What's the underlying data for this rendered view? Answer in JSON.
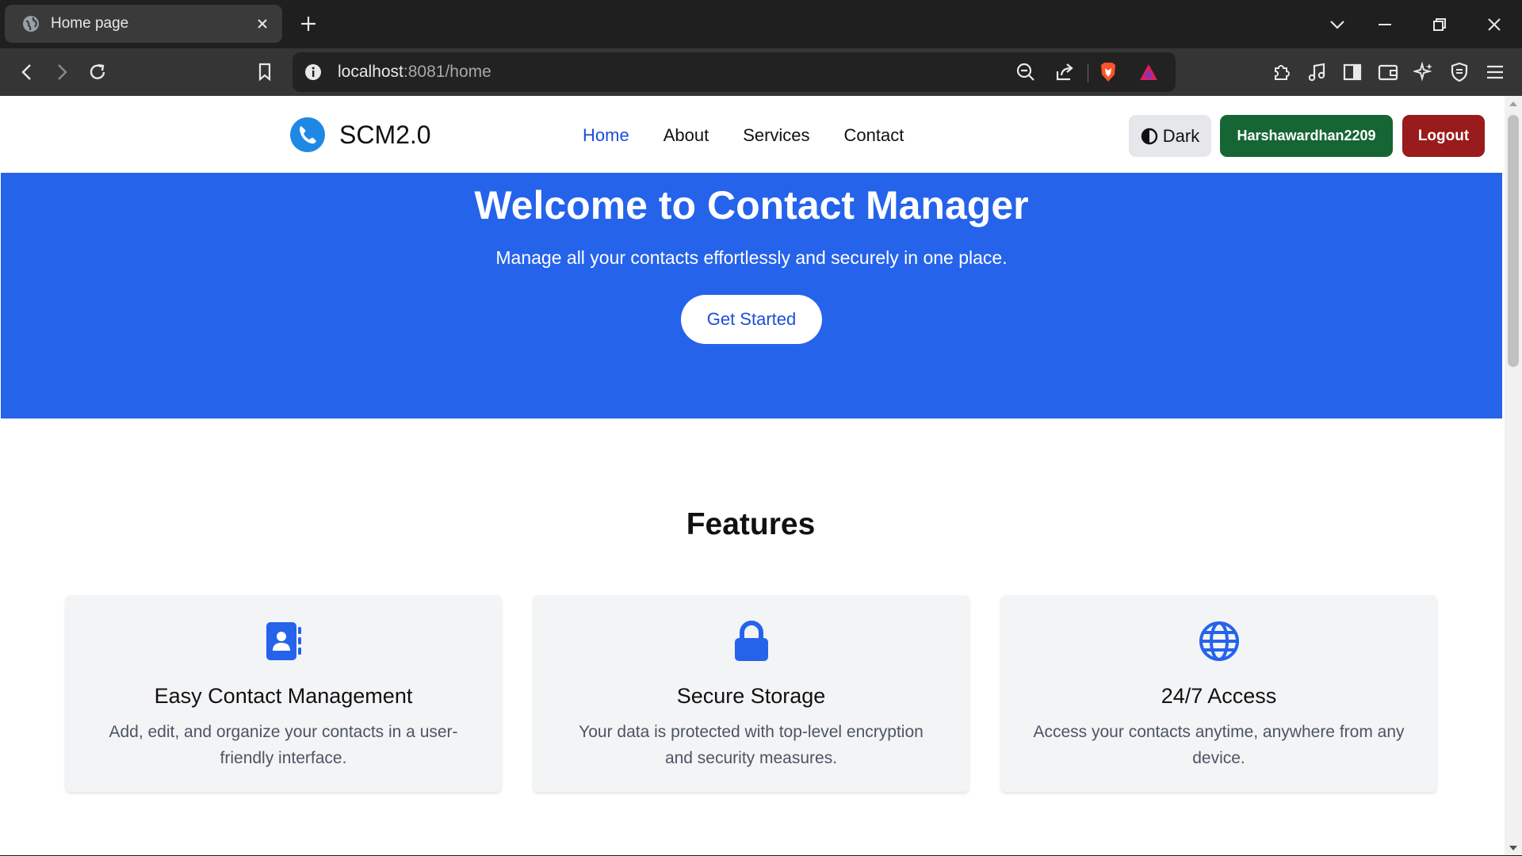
{
  "browser": {
    "tab_title": "Home page",
    "url_host": "localhost",
    "url_rest": ":8081/home"
  },
  "navbar": {
    "brand": "SCM2.0",
    "links": [
      "Home",
      "About",
      "Services",
      "Contact"
    ],
    "dark_label": "Dark",
    "user_label": "Harshawardhan2209",
    "logout_label": "Logout"
  },
  "hero": {
    "title": "Welcome to Contact Manager",
    "subtitle": "Manage all your contacts effortlessly and securely in one place.",
    "cta": "Get Started"
  },
  "features": {
    "title": "Features",
    "items": [
      {
        "icon": "address-book-icon",
        "title": "Easy Contact Management",
        "text": "Add, edit, and organize your contacts in a user-friendly interface."
      },
      {
        "icon": "lock-icon",
        "title": "Secure Storage",
        "text": "Your data is protected with top-level encryption and security measures."
      },
      {
        "icon": "globe-icon",
        "title": "24/7 Access",
        "text": "Access your contacts anytime, anywhere from any device."
      }
    ]
  },
  "colors": {
    "primary": "#2563eb",
    "active_link": "#1d4ed8",
    "user_button": "#166534",
    "logout_button": "#991b1b"
  }
}
